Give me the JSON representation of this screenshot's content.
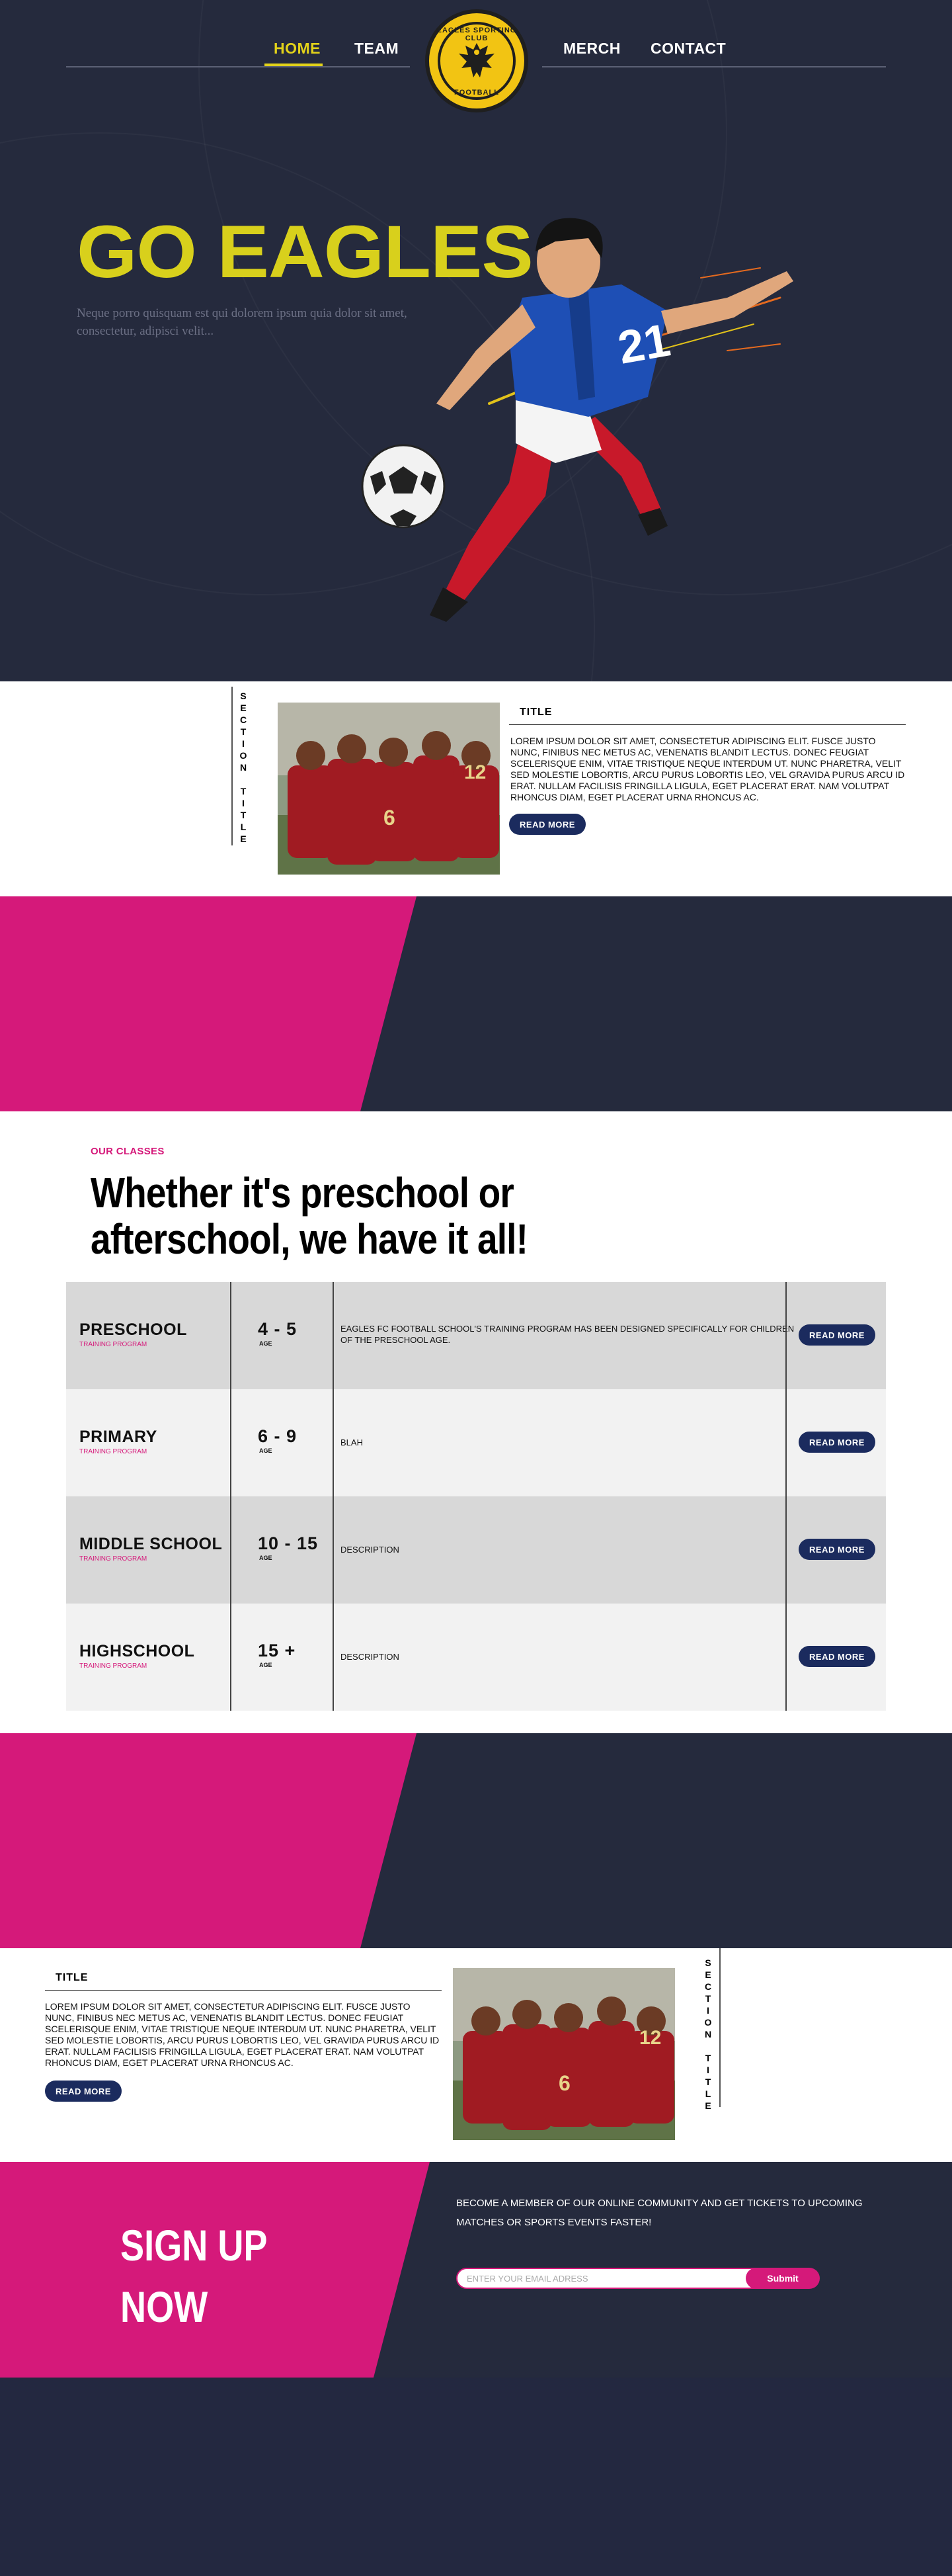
{
  "nav": {
    "home": "HOME",
    "team": "TEAM",
    "merch": "MERCH",
    "contact": "CONTACT",
    "crest_top": "EAGLES SPORTING CLUB",
    "crest_bottom": "FOOTBALL"
  },
  "hero": {
    "title": "GO EAGLES",
    "subtitle": "Neque porro quisquam est qui dolorem ipsum quia dolor sit amet, consectetur, adipisci velit...",
    "jersey_number": "21"
  },
  "feature1": {
    "section_title": "SECTION TITLE",
    "title": "TITLE",
    "body": "LOREM IPSUM DOLOR SIT AMET, CONSECTETUR ADIPISCING ELIT. FUSCE JUSTO NUNC, FINIBUS NEC METUS AC, VENENATIS BLANDIT LECTUS. DONEC FEUGIAT SCELERISQUE ENIM, VITAE TRISTIQUE NEQUE INTERDUM UT. NUNC PHARETRA, VELIT SED MOLESTIE LOBORTIS, ARCU PURUS LOBORTIS LEO, VEL GRAVIDA PURUS ARCU ID ERAT. NULLAM FACILISIS FRINGILLA LIGULA, EGET PLACERAT ERAT. NAM VOLUTPAT RHONCUS DIAM, EGET PLACERAT URNA RHONCUS AC.",
    "button": "READ MORE",
    "jersey_numbers": [
      "12",
      "6"
    ]
  },
  "classes": {
    "eyebrow": "OUR CLASSES",
    "heading": "Whether it's preschool or afterschool, we have it all!",
    "rows": [
      {
        "name": "PRESCHOOL",
        "sub": "TRAINING PROGRAM",
        "age": "4 - 5",
        "age_label": "AGE",
        "desc": "EAGLES FC FOOTBALL SCHOOL'S TRAINING PROGRAM HAS BEEN DESIGNED SPECIFICALLY FOR CHILDREN OF THE PRESCHOOL AGE.",
        "button": "READ MORE"
      },
      {
        "name": "PRIMARY",
        "sub": "TRAINING PROGRAM",
        "age": "6 - 9",
        "age_label": "AGE",
        "desc": "BLAH",
        "button": "READ MORE"
      },
      {
        "name": "MIDDLE SCHOOL",
        "sub": "TRAINING PROGRAM",
        "age": "10 - 15",
        "age_label": "AGE",
        "desc": "DESCRIPTION",
        "button": "READ MORE"
      },
      {
        "name": "HIGHSCHOOL",
        "sub": "TRAINING PROGRAM",
        "age": "15 +",
        "age_label": "AGE",
        "desc": "DESCRIPTION",
        "button": "READ MORE"
      }
    ]
  },
  "feature2": {
    "section_title": "SECTION TITLE",
    "title": "TITLE",
    "body": "LOREM IPSUM DOLOR SIT AMET, CONSECTETUR ADIPISCING ELIT. FUSCE JUSTO NUNC, FINIBUS NEC METUS AC, VENENATIS BLANDIT LECTUS. DONEC FEUGIAT SCELERISQUE ENIM, VITAE TRISTIQUE NEQUE INTERDUM UT. NUNC PHARETRA, VELIT SED MOLESTIE LOBORTIS, ARCU PURUS LOBORTIS LEO, VEL GRAVIDA PURUS ARCU ID ERAT. NULLAM FACILISIS FRINGILLA LIGULA, EGET PLACERAT ERAT. NAM VOLUTPAT RHONCUS DIAM, EGET PLACERAT URNA RHONCUS AC.",
    "button": "READ MORE",
    "jersey_numbers": [
      "12",
      "6"
    ]
  },
  "signup": {
    "title_line1": "SIGN UP",
    "title_line2": "NOW",
    "text": "BECOME A MEMBER OF OUR ONLINE COMMUNITY AND GET TICKETS TO UPCOMING MATCHES OR SPORTS EVENTS FASTER!",
    "email_placeholder": "ENTER YOUR EMAIL ADRESS",
    "submit": "Submit"
  },
  "colors": {
    "navy": "#252a3d",
    "pink": "#d5197a",
    "yellow": "#d8d01c",
    "button_navy": "#1b2b5e"
  }
}
